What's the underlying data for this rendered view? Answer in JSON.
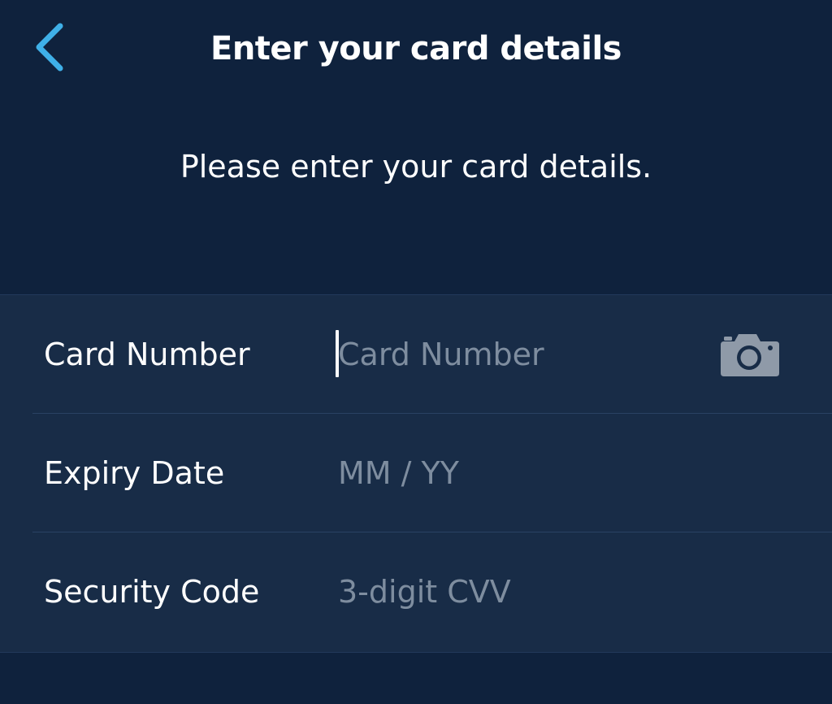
{
  "header": {
    "title": "Enter your card details",
    "back_icon": "chevron-left-icon"
  },
  "intro": {
    "text": "Please enter your card details."
  },
  "form": {
    "card_number": {
      "label": "Card Number",
      "placeholder": "Card Number",
      "value": "",
      "icon": "camera-icon"
    },
    "expiry_date": {
      "label": "Expiry Date",
      "placeholder": "MM / YY",
      "value": ""
    },
    "security_code": {
      "label": "Security Code",
      "placeholder": "3-digit CVV",
      "value": ""
    }
  },
  "colors": {
    "background": "#0f223d",
    "form_background": "#182c47",
    "accent": "#3fb0e8",
    "placeholder": "#7e8d9f",
    "icon": "#8f9aa8",
    "text": "#ffffff"
  }
}
